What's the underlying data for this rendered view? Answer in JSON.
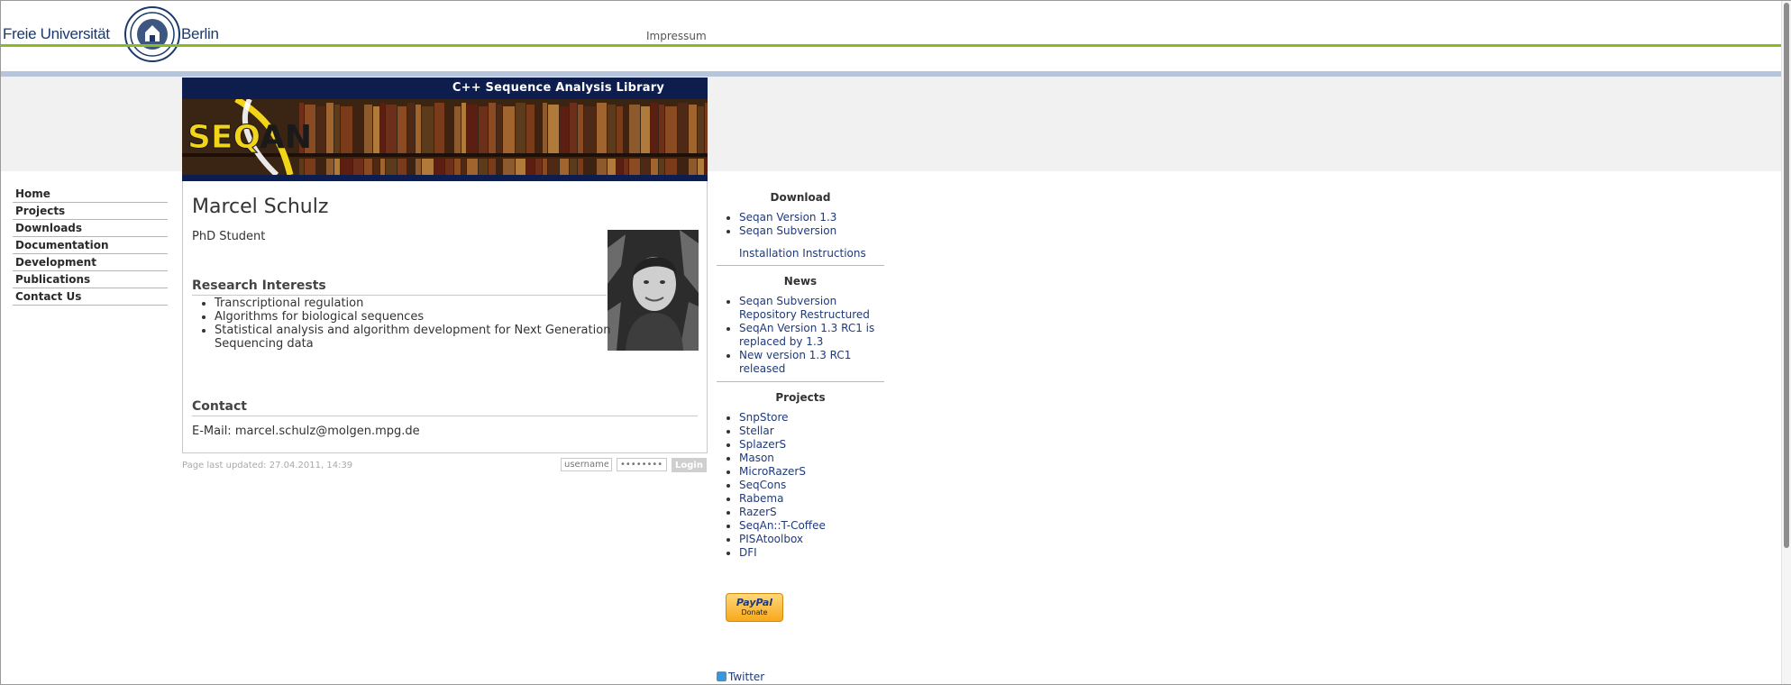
{
  "header": {
    "university_left": "Freie Universität",
    "university_right": "Berlin",
    "impressum": "Impressum"
  },
  "banner": {
    "title": "C++ Sequence Analysis Library",
    "logo_text": "SEQAN"
  },
  "nav": {
    "items": [
      "Home",
      "Projects",
      "Downloads",
      "Documentation",
      "Development",
      "Publications",
      "Contact Us"
    ]
  },
  "profile": {
    "name": "Marcel Schulz",
    "role": "PhD Student",
    "research_heading": "Research Interests",
    "research_items": [
      "Transcriptional regulation",
      "Algorithms for biological sequences",
      "Statistical analysis and algorithm development for Next Generation Sequencing data"
    ],
    "contact_heading": "Contact",
    "contact_line": "E-Mail: marcel.schulz@molgen.mpg.de"
  },
  "footer": {
    "last_updated": "Page last updated: 27.04.2011, 14:39",
    "username_placeholder": "username",
    "password_placeholder": "••••••••",
    "login_label": "Login"
  },
  "sidebar": {
    "download_heading": "Download",
    "download_items": [
      "Seqan Version 1.3",
      "Seqan Subversion"
    ],
    "install_link": "Installation Instructions",
    "news_heading": "News",
    "news_items": [
      "Seqan Subversion Repository Restructured",
      "SeqAn Version 1.3 RC1 is replaced by 1.3",
      "New version 1.3 RC1 released"
    ],
    "projects_heading": "Projects",
    "project_items": [
      "SnpStore",
      "Stellar",
      "SplazerS",
      "Mason",
      "MicroRazerS",
      "SeqCons",
      "Rabema",
      "RazerS",
      "SeqAn::T-Coffee",
      "PISAtoolbox",
      "DFI"
    ],
    "paypal_word": "PayPal",
    "paypal_donate": "Donate",
    "twitter": "Twitter"
  },
  "colors": {
    "accent_green": "#88bb22",
    "link_blue": "#1f3a7a",
    "banner_navy": "#0c1d4e"
  }
}
